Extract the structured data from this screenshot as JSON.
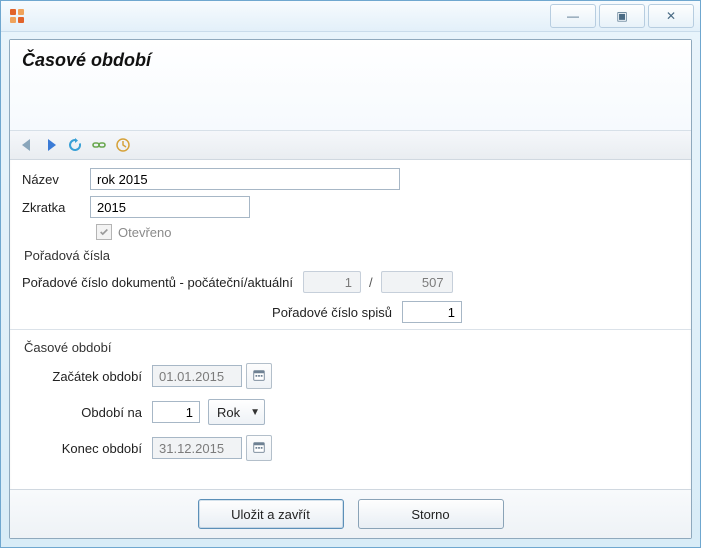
{
  "window": {
    "minimize_glyph": "—",
    "maximize_glyph": "▣",
    "close_glyph": "✕"
  },
  "header": {
    "title": "Časové období"
  },
  "form": {
    "nazev_label": "Název",
    "nazev_value": "rok 2015",
    "zkratka_label": "Zkratka",
    "zkratka_value": "2015",
    "otevreno_label": "Otevřeno"
  },
  "porad": {
    "section": "Pořadová čísla",
    "doc_label": "Pořadové číslo dokumentů - počáteční/aktuální",
    "doc_start": "1",
    "doc_sep": "/",
    "doc_current": "507",
    "spis_label": "Pořadové číslo spisů",
    "spis_value": "1"
  },
  "period": {
    "section": "Časové období",
    "start_label": "Začátek období",
    "start_value": "01.01.2015",
    "len_label": "Období na",
    "len_value": "1",
    "unit_label": "Rok",
    "end_label": "Konec období",
    "end_value": "31.12.2015"
  },
  "footer": {
    "save": "Uložit a zavřít",
    "cancel": "Storno"
  }
}
